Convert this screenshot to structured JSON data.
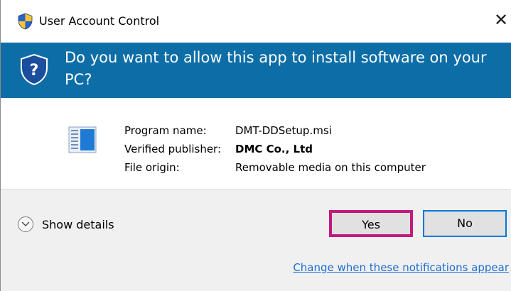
{
  "window": {
    "title": "User Account Control",
    "close_glyph": "✕"
  },
  "header": {
    "question": "Do you want to allow this app to install software on your PC?"
  },
  "details": {
    "rows": [
      {
        "label": "Program name:",
        "value": "DMT-DDSetup.msi",
        "bold": false
      },
      {
        "label": "Verified publisher:",
        "value": "DMC Co., Ltd",
        "bold": true
      },
      {
        "label": "File origin:",
        "value": "Removable media on this computer",
        "bold": false
      }
    ]
  },
  "footer": {
    "show_details_label": "Show details",
    "yes_label": "Yes",
    "no_label": "No",
    "notifications_link": "Change when these notifications appear"
  },
  "colors": {
    "header_blue": "#0d6ea7",
    "highlight_border": "#c11a7e",
    "default_button_border": "#0078d7",
    "link": "#1d6fd0"
  },
  "icons": {
    "title": "uac-shield-icon",
    "header": "question-shield-icon",
    "program": "installer-package-icon",
    "details_toggle": "chevron-down-icon"
  }
}
